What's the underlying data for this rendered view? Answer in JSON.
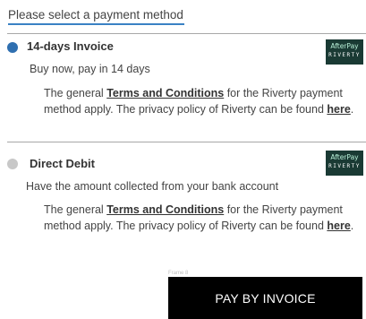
{
  "heading": "Please select a payment method",
  "options": [
    {
      "title": "14-days Invoice",
      "selected": true,
      "description": "Buy now, pay in 14 days",
      "terms_before": "The general ",
      "terms_link": "Terms and Conditions",
      "terms_middle": " for the Riverty payment method apply. The privacy policy of Riverty can be found ",
      "terms_here": "here",
      "terms_end": ".",
      "logo_top": "AfterPay",
      "logo_bottom": "RIVERTY"
    },
    {
      "title": "Direct Debit",
      "selected": false,
      "description": "Have the amount collected from your bank account",
      "terms_before": "The general ",
      "terms_link": "Terms and Conditions",
      "terms_middle": " for the Riverty payment method apply. The privacy policy of Riverty can be found ",
      "terms_here": "here",
      "terms_end": ".",
      "logo_top": "AfterPay",
      "logo_bottom": "RIVERTY"
    }
  ],
  "frame_label": "Frame 8",
  "pay_button_label": "PAY BY INVOICE",
  "colors": {
    "accent": "#2f6fb0",
    "underline": "#3a82c4",
    "logo_bg": "#1a3a34",
    "logo_text": "#b8f0d8",
    "button_bg": "#000000"
  }
}
